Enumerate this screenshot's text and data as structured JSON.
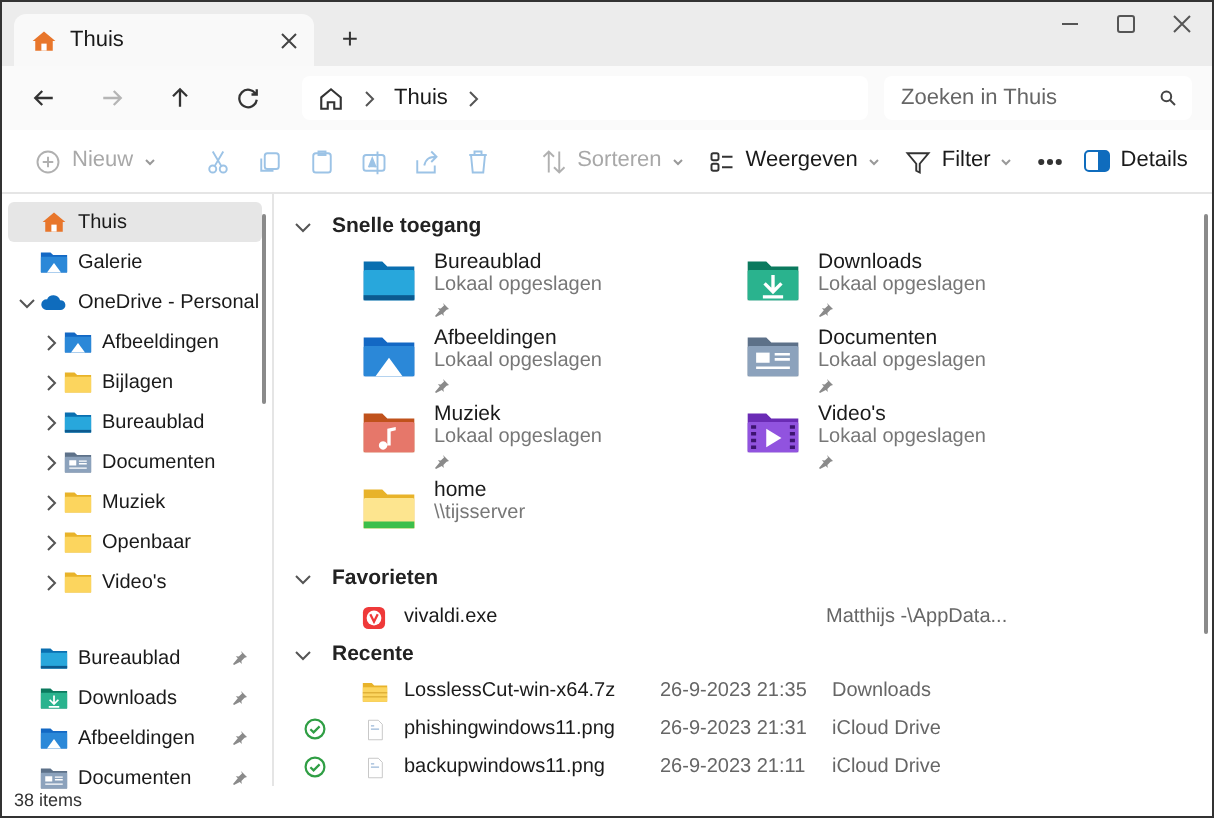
{
  "window": {
    "tab": {
      "title": "Thuis",
      "selected": true
    },
    "new_tab": "+"
  },
  "nav": [
    {
      "kind": "back",
      "disabled": false
    },
    {
      "kind": "forward",
      "disabled": true
    },
    {
      "kind": "up",
      "disabled": false
    },
    {
      "kind": "refresh",
      "disabled": false
    }
  ],
  "breadcrumb": [
    "Thuis"
  ],
  "search": {
    "placeholder": "Zoeken in Thuis"
  },
  "toolbar": [
    {
      "kind": "new",
      "label": "Nieuw",
      "disabled": true,
      "dropdown": true
    },
    {
      "kind": "cut",
      "disabled": true
    },
    {
      "kind": "copy",
      "disabled": true
    },
    {
      "kind": "paste",
      "disabled": true
    },
    {
      "kind": "rename",
      "disabled": true
    },
    {
      "kind": "share",
      "disabled": true
    },
    {
      "kind": "delete",
      "disabled": true
    },
    {
      "kind": "sort",
      "label": "Sorteren",
      "disabled": true,
      "dropdown": true
    },
    {
      "kind": "view",
      "label": "Weergeven",
      "disabled": false,
      "dropdown": true
    },
    {
      "kind": "filter",
      "label": "Filter",
      "disabled": false,
      "dropdown": true
    },
    {
      "kind": "more",
      "disabled": false
    }
  ],
  "details_button": "Details",
  "sidebar": {
    "items": [
      {
        "label": "Thuis",
        "kind": "home",
        "selected": true
      },
      {
        "label": "Galerie",
        "kind": "gallery",
        "selected": false
      },
      {
        "label": "OneDrive - Personal",
        "kind": "cloud",
        "selected": false,
        "expanded": true,
        "children": [
          {
            "label": "Afbeeldingen",
            "kind": "pictures",
            "selected": false,
            "expanded": false
          },
          {
            "label": "Bijlagen",
            "kind": "folder",
            "selected": false,
            "expanded": false
          },
          {
            "label": "Bureaublad",
            "kind": "desktop",
            "selected": false,
            "expanded": false
          },
          {
            "label": "Documenten",
            "kind": "documents",
            "selected": false,
            "expanded": false
          },
          {
            "label": "Muziek",
            "kind": "folder",
            "selected": false,
            "expanded": false
          },
          {
            "label": "Openbaar",
            "kind": "folder",
            "selected": false,
            "expanded": false
          },
          {
            "label": "Video's",
            "kind": "folder",
            "selected": false,
            "expanded": false
          }
        ]
      }
    ],
    "pinned": [
      {
        "label": "Bureaublad",
        "kind": "desktop",
        "selected": false,
        "pinned": true
      },
      {
        "label": "Downloads",
        "kind": "downloads",
        "selected": false,
        "pinned": true
      },
      {
        "label": "Afbeeldingen",
        "kind": "pictures",
        "selected": false,
        "pinned": true
      },
      {
        "label": "Documenten",
        "kind": "documents",
        "selected": false,
        "pinned": true
      }
    ]
  },
  "quick_access": {
    "title": "Snelle toegang",
    "expanded": true,
    "items": [
      {
        "name": "Bureaublad",
        "location": "Lokaal opgeslagen",
        "kind": "desktop",
        "pinned": true
      },
      {
        "name": "Downloads",
        "location": "Lokaal opgeslagen",
        "kind": "downloads",
        "pinned": true
      },
      {
        "name": "Afbeeldingen",
        "location": "Lokaal opgeslagen",
        "kind": "pictures",
        "pinned": true
      },
      {
        "name": "Documenten",
        "location": "Lokaal opgeslagen",
        "kind": "documents",
        "pinned": true
      },
      {
        "name": "Muziek",
        "location": "Lokaal opgeslagen",
        "kind": "music",
        "pinned": true
      },
      {
        "name": "Video's",
        "location": "Lokaal opgeslagen",
        "kind": "videos",
        "pinned": true
      },
      {
        "name": "home",
        "location": "\\\\tijsserver",
        "kind": "network",
        "pinned": false
      }
    ]
  },
  "favorites": {
    "title": "Favorieten",
    "expanded": true,
    "items": [
      {
        "name": "vivaldi.exe",
        "location": "Matthijs -\\AppData...",
        "kind": "app"
      }
    ]
  },
  "recent": {
    "title": "Recente",
    "expanded": true,
    "items": [
      {
        "name": "LosslessCut-win-x64.7z",
        "date": "26-9-2023 21:35",
        "location": "Downloads",
        "kind": "archive",
        "synced": false
      },
      {
        "name": "phishingwindows11.png",
        "date": "26-9-2023 21:31",
        "location": "iCloud Drive",
        "kind": "image",
        "synced": true
      },
      {
        "name": "backupwindows11.png",
        "date": "26-9-2023 21:11",
        "location": "iCloud Drive",
        "kind": "image",
        "synced": true
      }
    ]
  },
  "status_bar": {
    "count": "38 items"
  }
}
